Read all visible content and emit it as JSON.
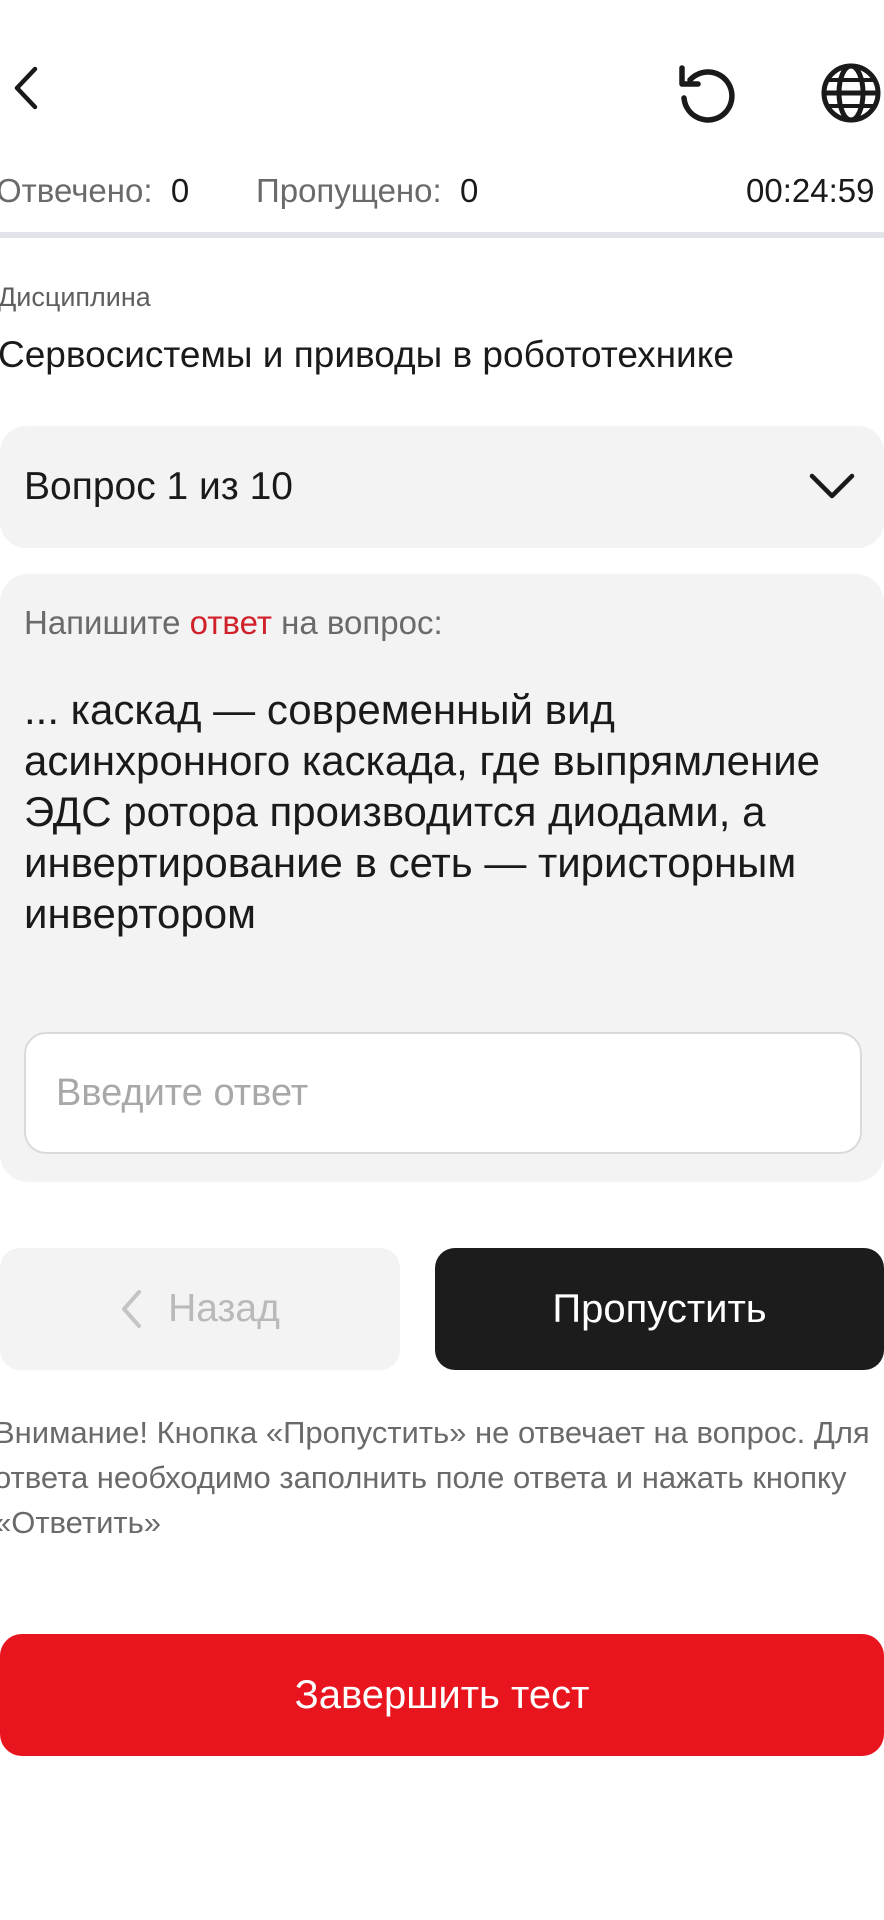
{
  "header": {
    "back_icon": "chevron-left-icon",
    "reset_icon": "reset-icon",
    "language_icon": "globe-icon"
  },
  "stats": {
    "answered_label": "Отвечено:",
    "answered_value": "0",
    "skipped_label": "Пропущено:",
    "skipped_value": "0",
    "timer": "00:24:59"
  },
  "discipline": {
    "label": "Дисциплина",
    "name": "Сервосистемы и приводы в робототехнике"
  },
  "question_selector": {
    "label": "Вопрос 1 из 10",
    "icon": "chevron-down-icon"
  },
  "question": {
    "prompt_before": "Напишите ",
    "prompt_accent": "ответ",
    "prompt_after": " на вопрос:",
    "text": "... каскад — современный вид асинхронного каскада, где выпрямление ЭДС ротора производится диодами, а инвертирование в сеть — тиристорным инвертором",
    "input_placeholder": "Введите ответ",
    "input_value": ""
  },
  "navigation": {
    "back_label": "Назад",
    "skip_label": "Пропустить"
  },
  "notice": "Внимание! Кнопка «Пропустить» не отвечает на вопрос. Для ответа необходимо заполнить поле ответа и нажать кнопку «Ответить»",
  "finish_label": "Завершить тест",
  "colors": {
    "accent_red": "#e8141e",
    "prompt_accent": "#d0202a",
    "dark_button": "#1c1c1c",
    "card_bg": "#f3f3f3"
  }
}
